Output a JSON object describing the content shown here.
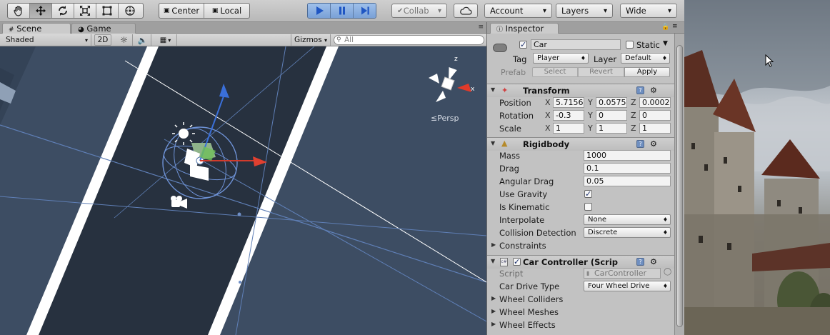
{
  "toolbar": {
    "pivot_label": "Center",
    "space_label": "Local",
    "collab_label": "Collab",
    "account_label": "Account",
    "layers_label": "Layers",
    "layout_label": "Wide",
    "active_tool": "move"
  },
  "scene": {
    "tab_scene": "Scene",
    "tab_game": "Game",
    "shading_mode": "Shaded",
    "mode_2d": "2D",
    "gizmos_label": "Gizmos",
    "search_placeholder": "All",
    "persp_label": "Persp",
    "axis_labels": {
      "x": "x",
      "z": "z"
    }
  },
  "inspector": {
    "tab_label": "Inspector",
    "object_name": "Car",
    "static_label": "Static",
    "tag_label": "Tag",
    "tag_value": "Player",
    "layer_label": "Layer",
    "layer_value": "Default",
    "prefab_label": "Prefab",
    "prefab_select": "Select",
    "prefab_revert": "Revert",
    "prefab_apply": "Apply",
    "transform": {
      "title": "Transform",
      "position_label": "Position",
      "position": {
        "x": "5.7156",
        "y": "0.0575",
        "z": "0.0002"
      },
      "rotation_label": "Rotation",
      "rotation": {
        "x": "-0.3",
        "y": "0",
        "z": "0"
      },
      "scale_label": "Scale",
      "scale": {
        "x": "1",
        "y": "1",
        "z": "1"
      },
      "axis": {
        "x": "X",
        "y": "Y",
        "z": "Z"
      }
    },
    "rigidbody": {
      "title": "Rigidbody",
      "mass_label": "Mass",
      "mass": "1000",
      "drag_label": "Drag",
      "drag": "0.1",
      "angular_drag_label": "Angular Drag",
      "angular_drag": "0.05",
      "use_gravity_label": "Use Gravity",
      "use_gravity": true,
      "is_kinematic_label": "Is Kinematic",
      "is_kinematic": false,
      "interpolate_label": "Interpolate",
      "interpolate": "None",
      "collision_label": "Collision Detection",
      "collision": "Discrete",
      "constraints_label": "Constraints"
    },
    "car_controller": {
      "title": "Car Controller (Scrip",
      "script_label": "Script",
      "script_value": "CarController",
      "drive_type_label": "Car Drive Type",
      "drive_type": "Four Wheel Drive",
      "wheel_colliders_label": "Wheel Colliders",
      "wheel_meshes_label": "Wheel Meshes",
      "wheel_effects_label": "Wheel Effects"
    }
  },
  "colors": {
    "viewport_bg": "#3d4d63",
    "road": "#27313f",
    "play_accent": "#2f63c9",
    "panel_bg": "#c2c2c2"
  }
}
